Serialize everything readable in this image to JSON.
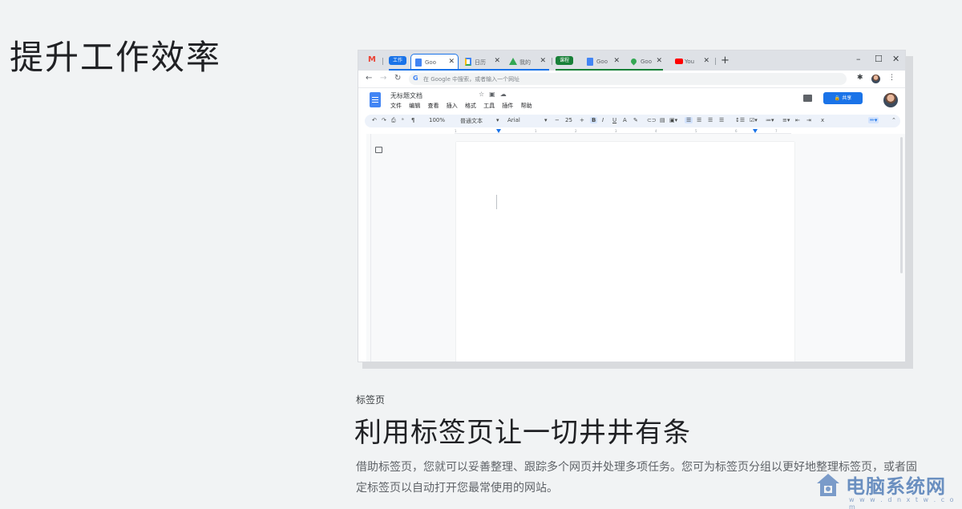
{
  "hero": {
    "title": "提升工作效率"
  },
  "browser": {
    "groups": [
      {
        "label": "工作",
        "color": "#1a73e8"
      },
      {
        "label": "课程",
        "color": "#188038"
      }
    ],
    "tabs": [
      {
        "label": "Goo",
        "icon": "docs-icon",
        "active": true
      },
      {
        "label": "日历",
        "icon": "calendar-icon"
      },
      {
        "label": "我的",
        "icon": "drive-icon"
      },
      {
        "label": "Goo",
        "icon": "translate-icon"
      },
      {
        "label": "Goo",
        "icon": "maps-icon"
      },
      {
        "label": "You",
        "icon": "youtube-icon"
      }
    ],
    "address_placeholder": "在 Google 中搜索，或者输入一个网址"
  },
  "docs": {
    "title": "无标题文档",
    "menu": [
      "文件",
      "编辑",
      "查看",
      "插入",
      "格式",
      "工具",
      "插件",
      "帮助"
    ],
    "share_label": "共享",
    "zoom": "100%",
    "style": "普通文本",
    "font": "Arial",
    "font_size": "25",
    "ruler_marks": [
      "1",
      "1",
      "2",
      "3",
      "4",
      "5",
      "6",
      "7"
    ]
  },
  "section": {
    "label": "标签页",
    "title": "利用标签页让一切井井有条",
    "body": "借助标签页，您就可以妥善整理、跟踪多个网页并处理多项任务。您可为标签页分组以更好地整理标签页，或者固定标签页以自动打开您最常使用的网站。"
  },
  "watermark": {
    "title": "电脑系统网",
    "url": "w w w . d n x t w . c o m"
  },
  "colors": {
    "accent": "#1a73e8",
    "background": "#f1f3f4"
  }
}
